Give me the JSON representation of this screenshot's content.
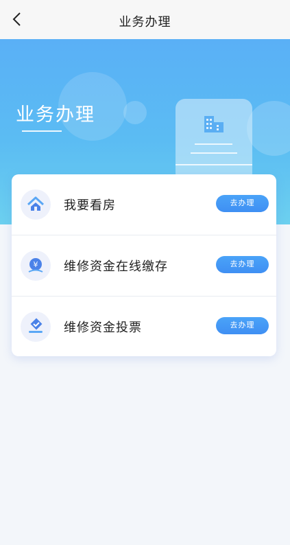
{
  "navbar": {
    "title": "业务办理",
    "back_icon": "chevron-left-icon"
  },
  "hero": {
    "title": "业务办理"
  },
  "colors": {
    "accent": "#3f8ff3",
    "hero_top": "#5ab0f6",
    "hero_bottom": "#6cd0ef"
  },
  "services": [
    {
      "label": "我要看房",
      "action": "去办理",
      "icon": "house-icon"
    },
    {
      "label": "维修资金在线缴存",
      "action": "去办理",
      "icon": "yuan-coin-icon"
    },
    {
      "label": "维修资金投票",
      "action": "去办理",
      "icon": "vote-check-icon"
    }
  ]
}
